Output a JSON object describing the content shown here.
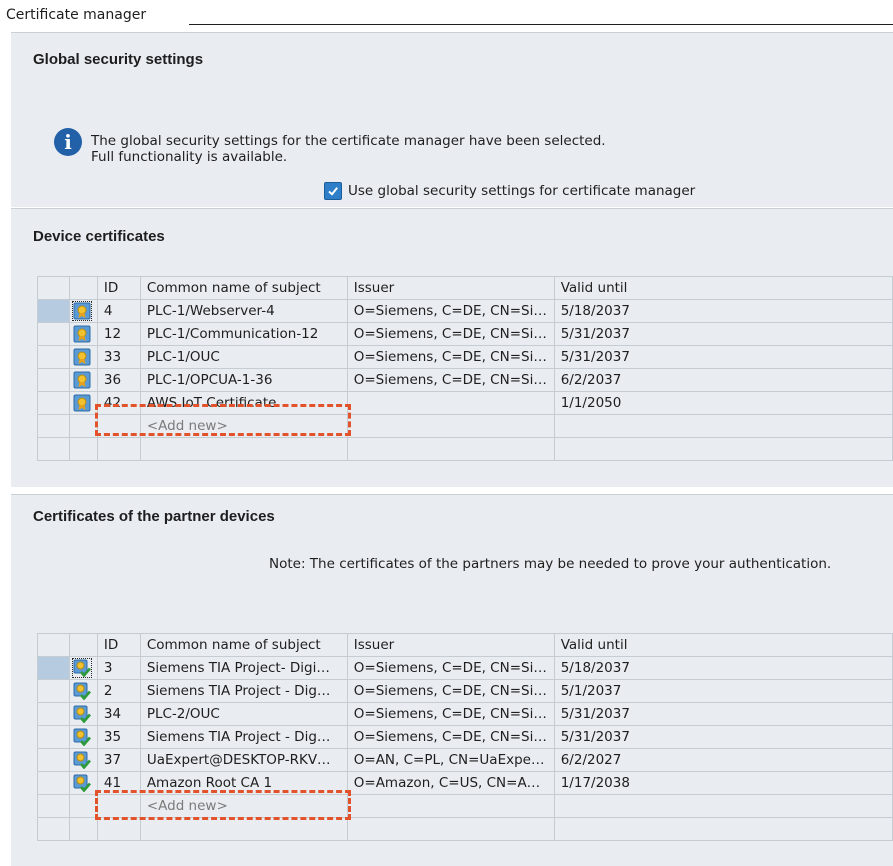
{
  "window_title": "Certificate manager",
  "global": {
    "heading": "Global security settings",
    "info_line1": "The global security settings for the certificate manager have been selected.",
    "info_line2": "Full functionality is available.",
    "checkbox_label": "Use global security settings for certificate manager",
    "checkbox_checked": true
  },
  "device": {
    "heading": "Device certificates",
    "columns": {
      "id": "ID",
      "common_name": "Common name of subject",
      "issuer": "Issuer",
      "valid_until": "Valid until"
    },
    "rows": [
      {
        "id": "4",
        "common_name": "PLC-1/Webserver-4",
        "issuer": "O=Siemens, C=DE, CN=Si…",
        "valid_until": "5/18/2037"
      },
      {
        "id": "12",
        "common_name": "PLC-1/Communication-12",
        "issuer": "O=Siemens, C=DE, CN=Si…",
        "valid_until": "5/31/2037"
      },
      {
        "id": "33",
        "common_name": "PLC-1/OUC",
        "issuer": "O=Siemens, C=DE, CN=Si…",
        "valid_until": "5/31/2037"
      },
      {
        "id": "36",
        "common_name": "PLC-1/OPCUA-1-36",
        "issuer": "O=Siemens, C=DE, CN=Si…",
        "valid_until": "6/2/2037"
      },
      {
        "id": "42",
        "common_name": "AWS IoT Certificate",
        "issuer": "",
        "valid_until": "1/1/2050"
      }
    ],
    "add_new": "<Add new>"
  },
  "partner": {
    "heading": "Certificates of the partner devices",
    "note": "Note:  The certificates of the partners may be needed to prove your authentication.",
    "columns": {
      "id": "ID",
      "common_name": "Common name of subject",
      "issuer": "Issuer",
      "valid_until": "Valid until"
    },
    "rows": [
      {
        "id": "3",
        "common_name": "Siemens TIA Project- Digi…",
        "issuer": "O=Siemens, C=DE, CN=Si…",
        "valid_until": "5/18/2037"
      },
      {
        "id": "2",
        "common_name": "Siemens TIA Project - Dig…",
        "issuer": "O=Siemens, C=DE, CN=Si…",
        "valid_until": "5/1/2037"
      },
      {
        "id": "34",
        "common_name": "PLC-2/OUC",
        "issuer": "O=Siemens, C=DE, CN=Si…",
        "valid_until": "5/31/2037"
      },
      {
        "id": "35",
        "common_name": "Siemens TIA Project - Dig…",
        "issuer": "O=Siemens, C=DE, CN=Si…",
        "valid_until": "5/31/2037"
      },
      {
        "id": "37",
        "common_name": "UaExpert@DESKTOP-RKV…",
        "issuer": "O=AN, C=PL, CN=UaExpe…",
        "valid_until": "6/2/2027"
      },
      {
        "id": "41",
        "common_name": "Amazon Root CA 1",
        "issuer": "O=Amazon, C=US, CN=A…",
        "valid_until": "1/17/2038"
      }
    ],
    "add_new": "<Add new>"
  },
  "colors": {
    "panel_bg": "#e9edf1",
    "highlight": "#e2532b",
    "checkbox": "#2f7fc8",
    "info_icon": "#2261a8"
  },
  "icons": {
    "device_row": "certificate-icon",
    "partner_row": "trusted-certificate-icon",
    "info": "info-icon",
    "checkbox": "checkmark-icon"
  }
}
